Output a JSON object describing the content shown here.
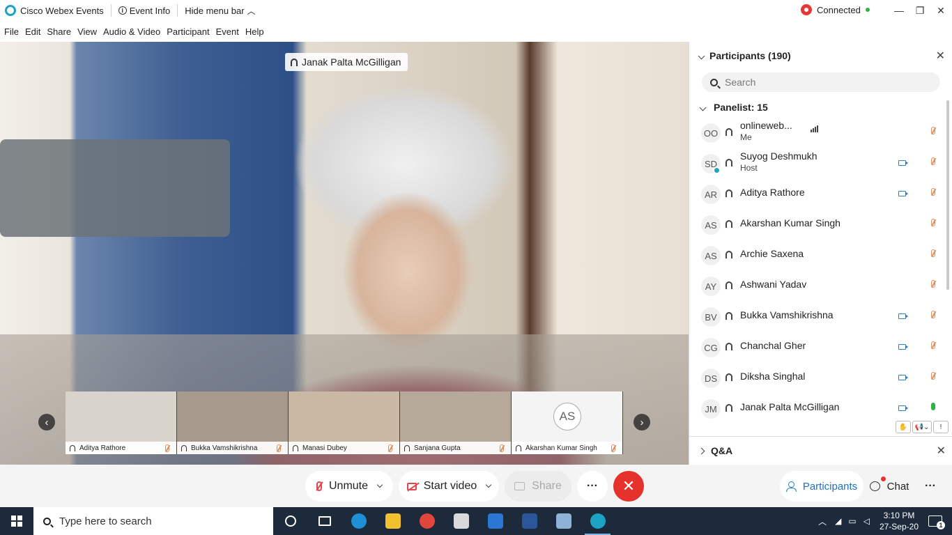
{
  "titlebar": {
    "app_name": "Cisco Webex Events",
    "event_info": "Event Info",
    "hide_menu": "Hide menu bar",
    "status": "Connected"
  },
  "menu": [
    "File",
    "Edit",
    "Share",
    "View",
    "Audio & Video",
    "Participant",
    "Event",
    "Help"
  ],
  "video": {
    "active_speaker": "Janak Palta McGilligan",
    "filmstrip": [
      {
        "name": "Aditya Rathore",
        "bg": "#d8d4cc"
      },
      {
        "name": "Bukka Vamshikrishna",
        "bg": "#a59a8c"
      },
      {
        "name": "Manasi Dubey",
        "bg": "#c9b8a4"
      },
      {
        "name": "Sanjana Gupta",
        "bg": "#b7a99a"
      },
      {
        "name": "Akarshan Kumar Singh",
        "bg": "#f4f4f4",
        "initials": "AS"
      }
    ]
  },
  "participants": {
    "title": "Participants (190)",
    "search_placeholder": "Search",
    "panelist_header": "Panelist: 15",
    "list": [
      {
        "initials": "OO",
        "name": "onlineweb...",
        "role": "Me",
        "video": false,
        "mic": "muted",
        "bars": true
      },
      {
        "initials": "SD",
        "name": "Suyog Deshmukh",
        "role": "Host",
        "video": true,
        "mic": "muted",
        "host": true
      },
      {
        "initials": "AR",
        "name": "Aditya Rathore",
        "role": "",
        "video": true,
        "mic": "muted"
      },
      {
        "initials": "AS",
        "name": "Akarshan Kumar Singh",
        "role": "",
        "video": false,
        "mic": "muted"
      },
      {
        "initials": "AS",
        "name": "Archie Saxena",
        "role": "",
        "video": false,
        "mic": "muted"
      },
      {
        "initials": "AY",
        "name": "Ashwani Yadav",
        "role": "",
        "video": false,
        "mic": "muted"
      },
      {
        "initials": "BV",
        "name": "Bukka Vamshikrishna",
        "role": "",
        "video": true,
        "mic": "muted"
      },
      {
        "initials": "CG",
        "name": "Chanchal Gher",
        "role": "",
        "video": true,
        "mic": "muted"
      },
      {
        "initials": "DS",
        "name": "Diksha Singhal",
        "role": "",
        "video": true,
        "mic": "muted"
      },
      {
        "initials": "JM",
        "name": "Janak Palta McGilligan",
        "role": "",
        "video": true,
        "mic": "on"
      }
    ],
    "tools": [
      "✋",
      "📢⌄",
      "!"
    ],
    "qa_title": "Q&A"
  },
  "controls": {
    "unmute": "Unmute",
    "start_video": "Start video",
    "share": "Share",
    "more": "···",
    "leave": "✕",
    "participants": "Participants",
    "chat": "Chat",
    "overflow": "···"
  },
  "taskbar": {
    "search_placeholder": "Type here to search",
    "time": "3:10 PM",
    "date": "27-Sep-20",
    "notifications": "1",
    "apps": [
      {
        "name": "cortana-icon",
        "color": "#1c2a3c"
      },
      {
        "name": "task-view-icon",
        "color": "#1c2a3c"
      },
      {
        "name": "edge-icon",
        "color": "#1f8fd6"
      },
      {
        "name": "file-explorer-icon",
        "color": "#f2c12e"
      },
      {
        "name": "chrome-icon",
        "color": "#e0463b"
      },
      {
        "name": "store-icon",
        "color": "#d9d9d9"
      },
      {
        "name": "mail-icon",
        "color": "#2a78d2"
      },
      {
        "name": "word-icon",
        "color": "#2b579a"
      },
      {
        "name": "paint-icon",
        "color": "#8fb3d8"
      },
      {
        "name": "webex-icon",
        "color": "#1aa3c2"
      }
    ]
  }
}
